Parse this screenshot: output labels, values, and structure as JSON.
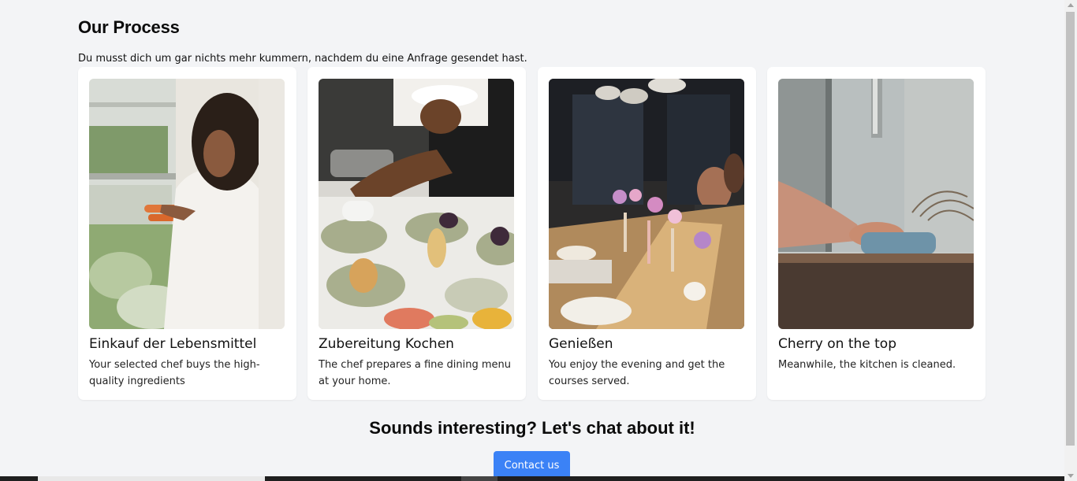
{
  "process": {
    "title": "Our Process",
    "description": "Du musst dich um gar nichts mehr kummern, nachdem du eine Anfrage gesendet hast.",
    "steps": [
      {
        "title": "Einkauf der Lebensmittel",
        "text": "Your selected chef buys the high-quality ingredients",
        "image": "woman-shopping-vegetables-photo"
      },
      {
        "title": "Zubereitung Kochen",
        "text": "The chef prepares a fine dining menu at your home.",
        "image": "chef-plating-dishes-photo"
      },
      {
        "title": "Genießen",
        "text": "You enjoy the evening and get the courses served.",
        "image": "dinner-party-table-photo"
      },
      {
        "title": "Cherry on the top",
        "text": "Meanwhile, the kitchen is cleaned.",
        "image": "kitchen-cleaning-photo"
      }
    ]
  },
  "cta": {
    "title": "Sounds interesting? Let's chat about it!",
    "button_label": "Contact us"
  },
  "colors": {
    "background": "#f3f4f6",
    "card": "#ffffff",
    "accent": "#3b82f6"
  }
}
